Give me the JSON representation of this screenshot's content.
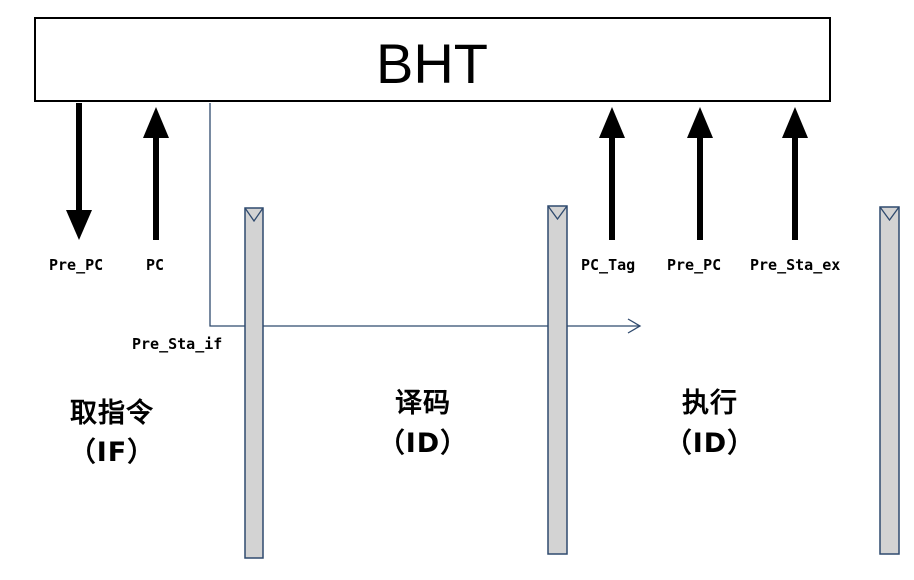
{
  "bht": {
    "title": "BHT"
  },
  "signals": {
    "pre_pc_left": "Pre_PC",
    "pc": "PC",
    "pre_sta_if": "Pre_Sta_if",
    "pc_tag": "PC_Tag",
    "pre_pc_right": "Pre_PC",
    "pre_sta_ex": "Pre_Sta_ex"
  },
  "stages": {
    "fetch": {
      "name": "取指令",
      "abbr": "（IF）"
    },
    "decode": {
      "name": "译码",
      "abbr": "（ID）"
    },
    "execute": {
      "name": "执行",
      "abbr": "（ID）"
    }
  },
  "colors": {
    "register_fill": "#d3d3d3",
    "register_stroke": "#2f4a6e",
    "flow_line": "#2f4a6e",
    "arrow": "#000000"
  }
}
